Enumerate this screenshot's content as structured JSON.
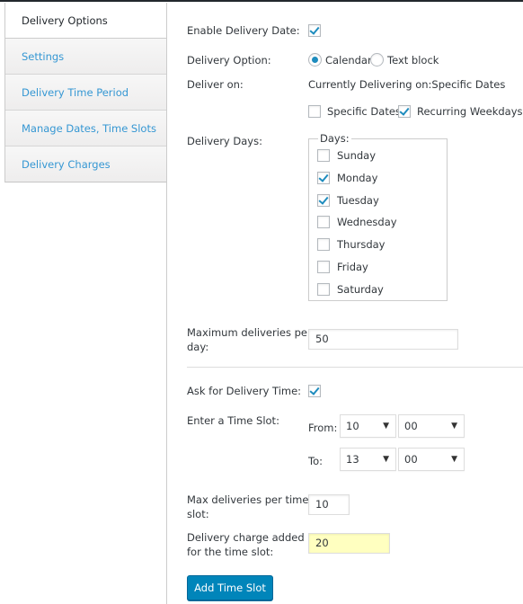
{
  "tabs": [
    {
      "label": "Delivery Options",
      "active": true
    },
    {
      "label": "Settings",
      "active": false
    },
    {
      "label": "Delivery Time Period",
      "active": false
    },
    {
      "label": "Manage Dates, Time Slots",
      "active": false
    },
    {
      "label": "Delivery Charges",
      "active": false
    }
  ],
  "form": {
    "enable_delivery_date": {
      "label": "Enable Delivery Date:",
      "checked": true
    },
    "delivery_option": {
      "label": "Delivery Option:",
      "options": [
        {
          "label": "Calendar",
          "selected": true
        },
        {
          "label": "Text block",
          "selected": false
        }
      ]
    },
    "deliver_on": {
      "label": "Deliver on:",
      "status": "Currently Delivering on:Specific Dates",
      "options": [
        {
          "label": "Specific Dates",
          "checked": false
        },
        {
          "label": "Recurring Weekdays",
          "checked": true
        }
      ]
    },
    "delivery_days": {
      "label": "Delivery Days:",
      "legend": "Days:",
      "days": [
        {
          "label": "Sunday",
          "checked": false
        },
        {
          "label": "Monday",
          "checked": true
        },
        {
          "label": "Tuesday",
          "checked": true
        },
        {
          "label": "Wednesday",
          "checked": false
        },
        {
          "label": "Thursday",
          "checked": false
        },
        {
          "label": "Friday",
          "checked": false
        },
        {
          "label": "Saturday",
          "checked": false
        }
      ]
    },
    "max_deliveries_per_day": {
      "label_line1": "Maximum deliveries per",
      "label_line2": "day:",
      "value": "50"
    },
    "ask_delivery_time": {
      "label": "Ask for Delivery Time:",
      "checked": true
    },
    "time_slot": {
      "label": "Enter a Time Slot:",
      "from_label": "From:",
      "from_hour": "10",
      "from_minute": "00",
      "to_label": "To:",
      "to_hour": "13",
      "to_minute": "00",
      "arrow": "▼"
    },
    "max_per_slot": {
      "label_line1": "Max deliveries per time",
      "label_line2": "slot:",
      "value": "10"
    },
    "slot_charge": {
      "label_line1": "Delivery charge added",
      "label_line2": "for the time slot:",
      "value": "20"
    },
    "add_button": "Add Time Slot"
  }
}
